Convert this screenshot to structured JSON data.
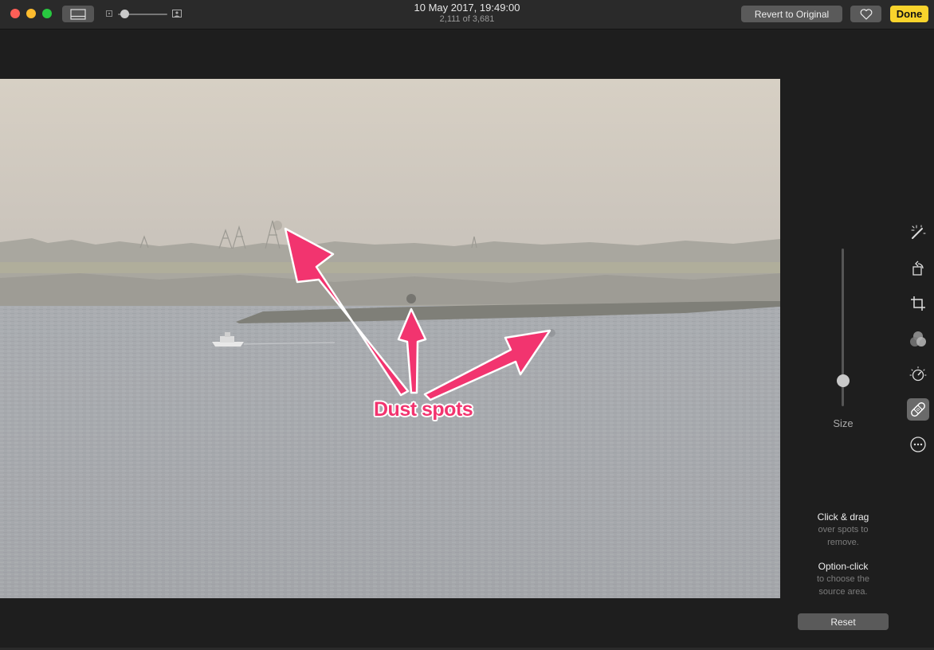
{
  "titlebar": {
    "date": "10 May 2017, 19:49:00",
    "count": "2,111 of 3,681",
    "revert_label": "Revert to Original",
    "done_label": "Done",
    "zoom_level": 0.05
  },
  "annotation": {
    "text": "Dust spots",
    "color": "#f2346f"
  },
  "sidebar": {
    "size_label": "Size",
    "size_value": 0.15,
    "tools": [
      {
        "name": "magic-wand-icon"
      },
      {
        "name": "rotate-icon"
      },
      {
        "name": "crop-icon"
      },
      {
        "name": "filters-icon"
      },
      {
        "name": "adjust-icon"
      },
      {
        "name": "retouch-icon",
        "active": true
      },
      {
        "name": "more-icon"
      }
    ],
    "hint1_title": "Click & drag",
    "hint1_line1": "over spots to",
    "hint1_line2": "remove.",
    "hint2_title": "Option-click",
    "hint2_line1": "to choose the",
    "hint2_line2": "source area.",
    "reset_label": "Reset"
  },
  "colors": {
    "accent_done": "#f8d32c",
    "annotation": "#f2346f"
  }
}
